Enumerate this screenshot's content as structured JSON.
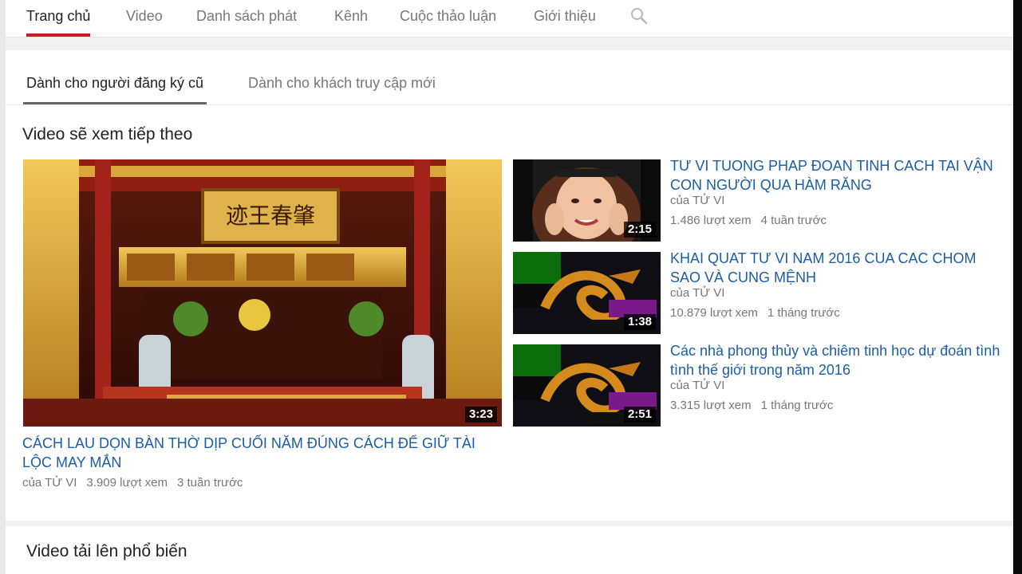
{
  "channel_nav": {
    "tabs": [
      {
        "label": "Trang chủ",
        "active": true
      },
      {
        "label": "Video"
      },
      {
        "label": "Danh sách phát"
      },
      {
        "label": "Kênh"
      },
      {
        "label": "Cuộc thảo luận"
      },
      {
        "label": "Giới thiệu"
      }
    ],
    "search_icon": "search-icon"
  },
  "sub_tabs": [
    {
      "label": "Dành cho người đăng ký cũ",
      "active": true
    },
    {
      "label": "Dành cho khách truy cập mới"
    }
  ],
  "up_next": {
    "title": "Video sẽ xem tiếp theo",
    "featured": {
      "title": "CÁCH LAU DỌN BÀN THỜ DỊP CUỐI NĂM ĐÚNG CÁCH ĐỂ GIỮ TÀI LỘC MAY MẮN",
      "channel": "của TỬ VI",
      "views": "3.909 lượt xem",
      "age": "3 tuần trước",
      "duration": "3:23"
    },
    "list": [
      {
        "title": "TƯ VI TUONG PHAP ĐOAN TINH CACH TAI VẬN CON NGƯỜI QUA HÀM RĂNG",
        "channel": "của TỬ VI",
        "views": "1.486 lượt xem",
        "age": "4 tuần trước",
        "duration": "2:15"
      },
      {
        "title": "KHAI QUAT TƯ VI NAM 2016 CUA CAC CHOM SAO VÀ CUNG MỆNH",
        "channel": "của TỬ VI",
        "views": "10.879 lượt xem",
        "age": "1 tháng trước",
        "duration": "1:38"
      },
      {
        "title": "Các nhà phong thủy và chiêm tinh học dự đoán tình tình thế giới trong năm 2016",
        "channel": "của TỬ VI",
        "views": "3.315 lượt xem",
        "age": "1 tháng trước",
        "duration": "2:51"
      }
    ]
  },
  "popular": {
    "title": "Video tải lên phổ biến"
  },
  "colors": {
    "link": "#1b5ea6",
    "active_tab_underline": "#cc181e",
    "page_bg": "#f1f1f1"
  }
}
